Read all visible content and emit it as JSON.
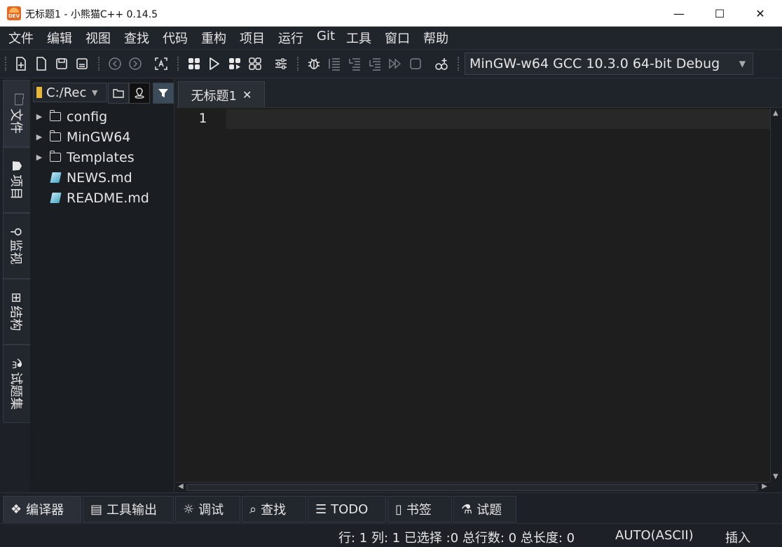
{
  "window": {
    "title": "无标题1 - 小熊猫C++ 0.14.5",
    "app_icon_text": "DEV",
    "minimize": "—",
    "maximize": "☐",
    "close": "✕"
  },
  "menu": [
    "文件",
    "编辑",
    "视图",
    "查找",
    "代码",
    "重构",
    "项目",
    "运行",
    "Git",
    "工具",
    "窗口",
    "帮助"
  ],
  "toolbar": {
    "compiler": "MinGW-w64 GCC 10.3.0 64-bit Debug"
  },
  "left_tabs": [
    {
      "icon": "🗀",
      "label": "文件"
    },
    {
      "icon": "☗",
      "label": "项目"
    },
    {
      "icon": "⚲",
      "label": "监视"
    },
    {
      "icon": "⊞",
      "label": "结构"
    },
    {
      "icon": "⚗",
      "label": "试题集"
    }
  ],
  "file_panel": {
    "path": "C:/Rec",
    "tree": [
      {
        "name": "config",
        "type": "folder"
      },
      {
        "name": "MinGW64",
        "type": "folder"
      },
      {
        "name": "Templates",
        "type": "folder"
      },
      {
        "name": "NEWS.md",
        "type": "file"
      },
      {
        "name": "README.md",
        "type": "file"
      }
    ]
  },
  "editor": {
    "tab_title": "无标题1",
    "tab_close": "✕",
    "line_number": "1"
  },
  "bottom_tabs": [
    {
      "icon": "❖",
      "label": "编译器"
    },
    {
      "icon": "▤",
      "label": "工具输出"
    },
    {
      "icon": "☼",
      "label": "调试"
    },
    {
      "icon": "⌕",
      "label": "查找"
    },
    {
      "icon": "☰",
      "label": "TODO"
    },
    {
      "icon": "▯",
      "label": "书签"
    },
    {
      "icon": "⚗",
      "label": "试题"
    }
  ],
  "status": {
    "position": "行: 1 列: 1 已选择 :0 总行数: 0 总长度: 0",
    "encoding": "AUTO(ASCII)",
    "mode": "插入"
  }
}
